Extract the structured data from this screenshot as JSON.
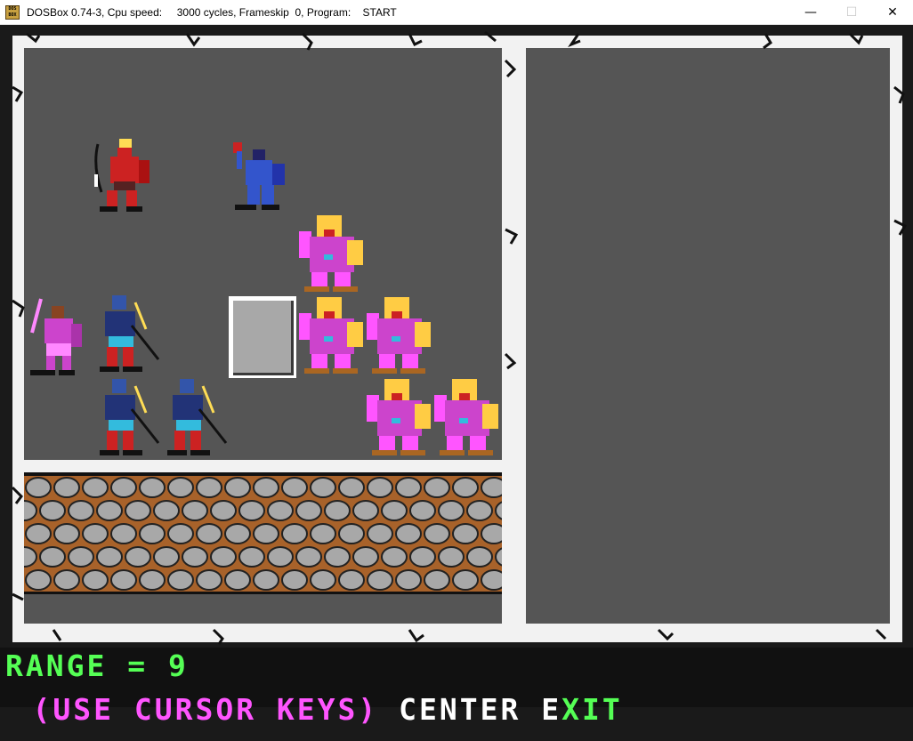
{
  "window": {
    "title": "DOSBox 0.74-3, Cpu speed:     3000 cycles, Frameskip  0, Program:    START",
    "icon": "dosbox-icon",
    "minimize_label": "—",
    "maximize_label": "☐",
    "close_label": "✕"
  },
  "status": {
    "range_text": "RANGE = 9",
    "cursor_hint": "(USE CURSOR KEYS) ",
    "center_label": "CENTER ",
    "exit_first": "E",
    "exit_rest": "XIT"
  },
  "scene": {
    "party": [
      "archer",
      "blue-fighter",
      "pink-warrior"
    ],
    "enemies": [
      "dark-elf",
      "dark-elf",
      "dark-elf",
      "dark-elf",
      "owlbear",
      "owlbear",
      "owlbear",
      "owlbear",
      "owlbear"
    ],
    "obstacle": "stone-block",
    "colors": {
      "frame": "#f2f2f2",
      "panel": "#555555",
      "range_text": "#55ff55",
      "hint_text": "#ff55ff",
      "option_text": "#ffffff"
    }
  }
}
